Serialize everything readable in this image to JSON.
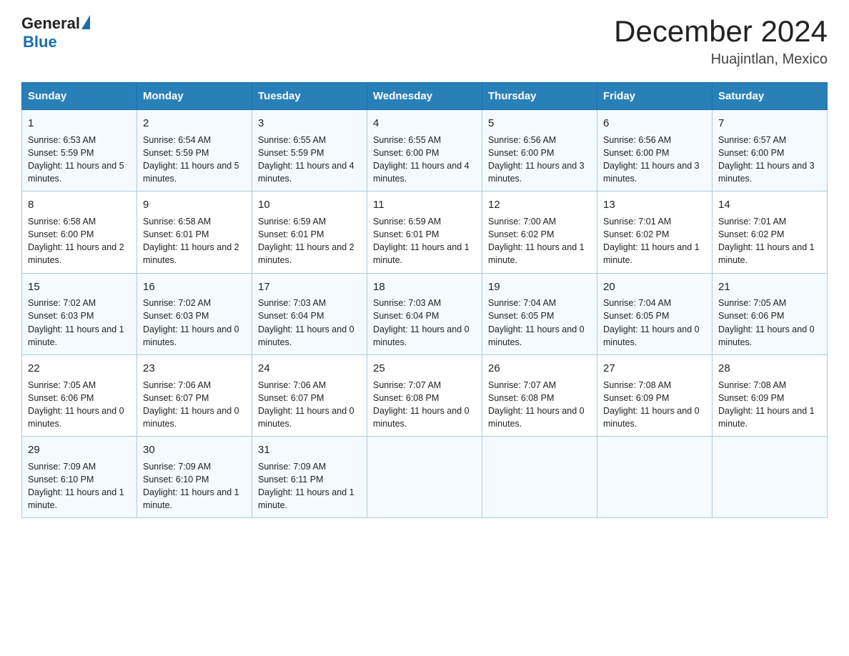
{
  "header": {
    "logo_general": "General",
    "logo_blue": "Blue",
    "month_title": "December 2024",
    "location": "Huajintlan, Mexico"
  },
  "days_of_week": [
    "Sunday",
    "Monday",
    "Tuesday",
    "Wednesday",
    "Thursday",
    "Friday",
    "Saturday"
  ],
  "weeks": [
    [
      {
        "day": "1",
        "sunrise": "6:53 AM",
        "sunset": "5:59 PM",
        "daylight": "11 hours and 5 minutes."
      },
      {
        "day": "2",
        "sunrise": "6:54 AM",
        "sunset": "5:59 PM",
        "daylight": "11 hours and 5 minutes."
      },
      {
        "day": "3",
        "sunrise": "6:55 AM",
        "sunset": "5:59 PM",
        "daylight": "11 hours and 4 minutes."
      },
      {
        "day": "4",
        "sunrise": "6:55 AM",
        "sunset": "6:00 PM",
        "daylight": "11 hours and 4 minutes."
      },
      {
        "day": "5",
        "sunrise": "6:56 AM",
        "sunset": "6:00 PM",
        "daylight": "11 hours and 3 minutes."
      },
      {
        "day": "6",
        "sunrise": "6:56 AM",
        "sunset": "6:00 PM",
        "daylight": "11 hours and 3 minutes."
      },
      {
        "day": "7",
        "sunrise": "6:57 AM",
        "sunset": "6:00 PM",
        "daylight": "11 hours and 3 minutes."
      }
    ],
    [
      {
        "day": "8",
        "sunrise": "6:58 AM",
        "sunset": "6:00 PM",
        "daylight": "11 hours and 2 minutes."
      },
      {
        "day": "9",
        "sunrise": "6:58 AM",
        "sunset": "6:01 PM",
        "daylight": "11 hours and 2 minutes."
      },
      {
        "day": "10",
        "sunrise": "6:59 AM",
        "sunset": "6:01 PM",
        "daylight": "11 hours and 2 minutes."
      },
      {
        "day": "11",
        "sunrise": "6:59 AM",
        "sunset": "6:01 PM",
        "daylight": "11 hours and 1 minute."
      },
      {
        "day": "12",
        "sunrise": "7:00 AM",
        "sunset": "6:02 PM",
        "daylight": "11 hours and 1 minute."
      },
      {
        "day": "13",
        "sunrise": "7:01 AM",
        "sunset": "6:02 PM",
        "daylight": "11 hours and 1 minute."
      },
      {
        "day": "14",
        "sunrise": "7:01 AM",
        "sunset": "6:02 PM",
        "daylight": "11 hours and 1 minute."
      }
    ],
    [
      {
        "day": "15",
        "sunrise": "7:02 AM",
        "sunset": "6:03 PM",
        "daylight": "11 hours and 1 minute."
      },
      {
        "day": "16",
        "sunrise": "7:02 AM",
        "sunset": "6:03 PM",
        "daylight": "11 hours and 0 minutes."
      },
      {
        "day": "17",
        "sunrise": "7:03 AM",
        "sunset": "6:04 PM",
        "daylight": "11 hours and 0 minutes."
      },
      {
        "day": "18",
        "sunrise": "7:03 AM",
        "sunset": "6:04 PM",
        "daylight": "11 hours and 0 minutes."
      },
      {
        "day": "19",
        "sunrise": "7:04 AM",
        "sunset": "6:05 PM",
        "daylight": "11 hours and 0 minutes."
      },
      {
        "day": "20",
        "sunrise": "7:04 AM",
        "sunset": "6:05 PM",
        "daylight": "11 hours and 0 minutes."
      },
      {
        "day": "21",
        "sunrise": "7:05 AM",
        "sunset": "6:06 PM",
        "daylight": "11 hours and 0 minutes."
      }
    ],
    [
      {
        "day": "22",
        "sunrise": "7:05 AM",
        "sunset": "6:06 PM",
        "daylight": "11 hours and 0 minutes."
      },
      {
        "day": "23",
        "sunrise": "7:06 AM",
        "sunset": "6:07 PM",
        "daylight": "11 hours and 0 minutes."
      },
      {
        "day": "24",
        "sunrise": "7:06 AM",
        "sunset": "6:07 PM",
        "daylight": "11 hours and 0 minutes."
      },
      {
        "day": "25",
        "sunrise": "7:07 AM",
        "sunset": "6:08 PM",
        "daylight": "11 hours and 0 minutes."
      },
      {
        "day": "26",
        "sunrise": "7:07 AM",
        "sunset": "6:08 PM",
        "daylight": "11 hours and 0 minutes."
      },
      {
        "day": "27",
        "sunrise": "7:08 AM",
        "sunset": "6:09 PM",
        "daylight": "11 hours and 0 minutes."
      },
      {
        "day": "28",
        "sunrise": "7:08 AM",
        "sunset": "6:09 PM",
        "daylight": "11 hours and 1 minute."
      }
    ],
    [
      {
        "day": "29",
        "sunrise": "7:09 AM",
        "sunset": "6:10 PM",
        "daylight": "11 hours and 1 minute."
      },
      {
        "day": "30",
        "sunrise": "7:09 AM",
        "sunset": "6:10 PM",
        "daylight": "11 hours and 1 minute."
      },
      {
        "day": "31",
        "sunrise": "7:09 AM",
        "sunset": "6:11 PM",
        "daylight": "11 hours and 1 minute."
      },
      null,
      null,
      null,
      null
    ]
  ],
  "labels": {
    "sunrise": "Sunrise:",
    "sunset": "Sunset:",
    "daylight": "Daylight:"
  }
}
